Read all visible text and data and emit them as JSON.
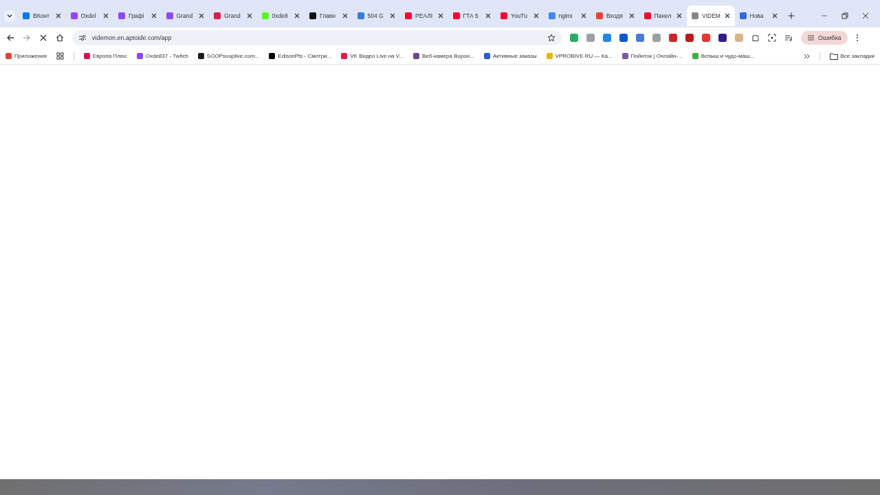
{
  "tabs": [
    {
      "title": "ВКонт",
      "color": "#0077ff",
      "selected": false
    },
    {
      "title": "Oxdel",
      "color": "#9146ff",
      "selected": false
    },
    {
      "title": "Графі",
      "color": "#9146ff",
      "selected": false
    },
    {
      "title": "Grand",
      "color": "#9146ff",
      "selected": false
    },
    {
      "title": "Grand",
      "color": "#e8194b",
      "selected": false
    },
    {
      "title": "0xde8",
      "color": "#53fc18",
      "selected": false
    },
    {
      "title": "Главн",
      "color": "#111111",
      "selected": false
    },
    {
      "title": "504 G",
      "color": "#3a7bd5",
      "selected": false
    },
    {
      "title": "РЕАЛІ",
      "color": "#ff0033",
      "selected": false
    },
    {
      "title": "ГТА 5",
      "color": "#ff0033",
      "selected": false
    },
    {
      "title": "YouTu",
      "color": "#ff0033",
      "selected": false
    },
    {
      "title": "nginx",
      "color": "#4285f4",
      "selected": false
    },
    {
      "title": "Входя",
      "color": "#ea4335",
      "selected": false
    },
    {
      "title": "Панел",
      "color": "#ff0033",
      "selected": false
    },
    {
      "title": "VIDEM",
      "color": "#888888",
      "selected": true
    },
    {
      "title": "Нова",
      "color": "#3367d6",
      "selected": false
    }
  ],
  "address_bar": {
    "url": "videmon.en.aptoide.com/app",
    "loading": true
  },
  "profile_button": {
    "label": "Ошибка"
  },
  "bookmarks": [
    {
      "label": "Приложения",
      "color": "#e94235"
    },
    {
      "label": "Европа Плюс",
      "color": "#d4145a"
    },
    {
      "label": "Oxde837 - Twitch",
      "color": "#9146ff"
    },
    {
      "label": "SOOPsooplive.com...",
      "color": "#1b1b1b"
    },
    {
      "label": "EdisonPts - Смотри...",
      "color": "#000000"
    },
    {
      "label": "VK Видео Live на V...",
      "color": "#e8194b"
    },
    {
      "label": "Веб-камера Ворон...",
      "color": "#6b4a8a"
    },
    {
      "label": "Активные заказы",
      "color": "#2a5bd7"
    },
    {
      "label": "VPROBIVE.RU — Ка...",
      "color": "#e6b800"
    },
    {
      "label": "Пойнток | Онлайн-...",
      "color": "#7a5c9e"
    },
    {
      "label": "Вспыш и чудо-маш...",
      "color": "#3cb043"
    }
  ],
  "all_bookmarks": {
    "label": "Все закладки"
  }
}
